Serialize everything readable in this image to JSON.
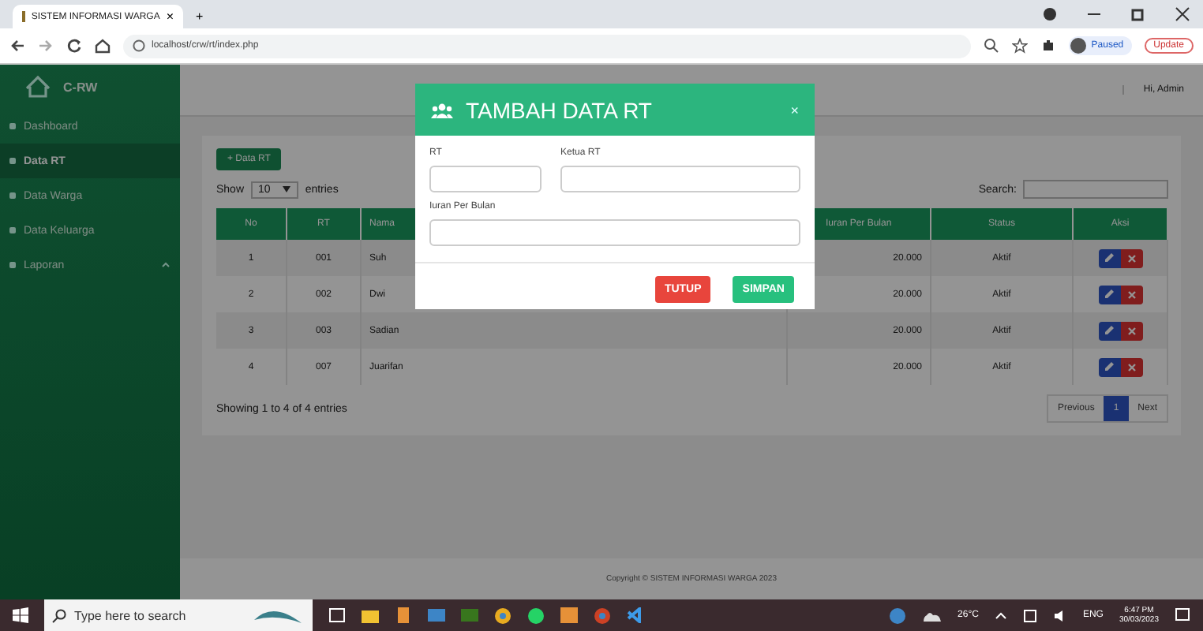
{
  "browser": {
    "tab_title": "SISTEM INFORMASI WARGA",
    "tab_close": "×",
    "new_tab": "+",
    "url": "localhost/crw/rt/index.php",
    "profile_label": "Paused",
    "update_label": "Update"
  },
  "sidebar": {
    "brand": "C-RW",
    "items": [
      {
        "label": "Dashboard",
        "selected": false,
        "has_submenu": false
      },
      {
        "label": "Data RT",
        "selected": true,
        "has_submenu": false
      },
      {
        "label": "Data Warga",
        "selected": false,
        "has_submenu": false
      },
      {
        "label": "Data Keluarga",
        "selected": false,
        "has_submenu": false
      },
      {
        "label": "Laporan",
        "selected": false,
        "has_submenu": true
      }
    ]
  },
  "header": {
    "user": "Hi, Admin"
  },
  "content": {
    "add_button": "+ Data RT",
    "show_label": "Show",
    "page_length": "10",
    "entries_label": "entries",
    "search_label": "Search:",
    "columns": [
      "No",
      "RT",
      "Nama",
      "Iuran Per Bulan",
      "Status",
      "Aksi"
    ],
    "rows": [
      {
        "no": "1",
        "rt": "001",
        "nama": "Suh",
        "iuran": "20.000",
        "status": "Aktif"
      },
      {
        "no": "2",
        "rt": "002",
        "nama": "Dwi",
        "iuran": "20.000",
        "status": "Aktif"
      },
      {
        "no": "3",
        "rt": "003",
        "nama": "Sadian",
        "iuran": "20.000",
        "status": "Aktif"
      },
      {
        "no": "4",
        "rt": "007",
        "nama": "Juarifan",
        "iuran": "20.000",
        "status": "Aktif"
      }
    ],
    "info": "Showing 1 to 4 of 4 entries",
    "pagination": {
      "previous": "Previous",
      "pages": [
        {
          "label": "1",
          "selected": true
        }
      ],
      "next": "Next"
    }
  },
  "footer": "Copyright © SISTEM INFORMASI WARGA 2023",
  "modal": {
    "title": "TAMBAH DATA RT",
    "close": "×",
    "fields": [
      {
        "label": "RT"
      },
      {
        "label": "Ketua RT"
      },
      {
        "label": "Iuran Per Bulan"
      }
    ],
    "buttons": [
      {
        "label": "TUTUP",
        "kind": "danger"
      },
      {
        "label": "SIMPAN",
        "kind": "primary"
      }
    ]
  },
  "taskbar": {
    "search_placeholder": "Type here to search",
    "weather": "26°C",
    "language": "ENG",
    "time": "6:47 PM",
    "date": "30/03/2023"
  }
}
